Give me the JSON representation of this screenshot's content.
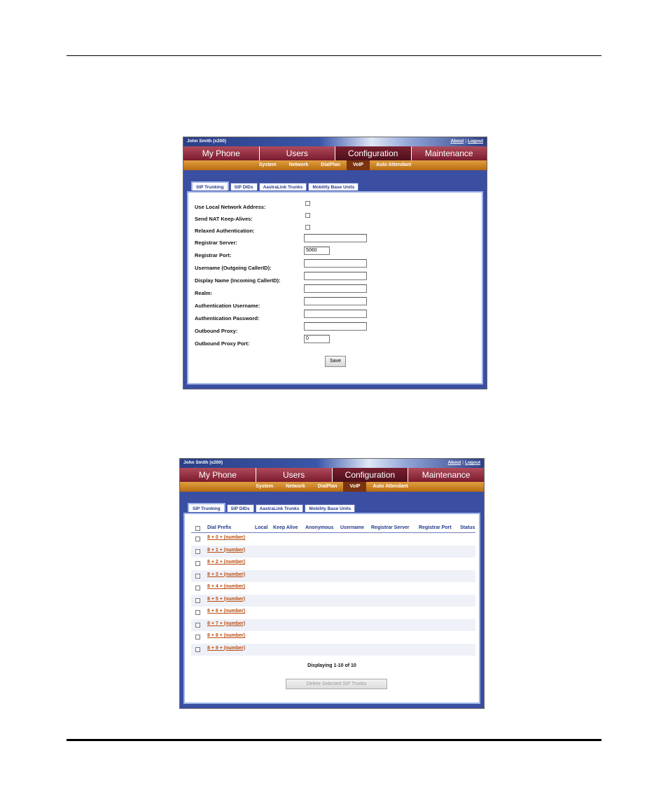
{
  "shot1": {
    "topbar": {
      "user": "John Smith (x200)",
      "about": "About",
      "separator": "|",
      "logout": "Logout"
    },
    "main_tabs": [
      "My Phone",
      "Users",
      "Configuration",
      "Maintenance"
    ],
    "sub_nav": [
      "System",
      "Network",
      "DialPlan",
      "VoIP",
      "Auto Attendant"
    ],
    "sub_tabs": [
      "SIP Trunking",
      "SIP DIDs",
      "AastraLink Trunks",
      "Mobility Base Units"
    ],
    "form": {
      "use_local_network_address": "Use Local Network Address:",
      "send_nat_keep_alives": "Send NAT Keep-Alives:",
      "relaxed_authentication": "Relaxed Authentication:",
      "registrar_server": "Registrar Server:",
      "registrar_port": "Registrar Port:",
      "registrar_port_value": "5060",
      "username": "Username (Outgoing CallerID):",
      "display_name": "Display Name (Incoming CallerID):",
      "realm": "Realm:",
      "auth_username": "Authentication Username:",
      "auth_password": "Authentication Password:",
      "outbound_proxy": "Outbound Proxy:",
      "outbound_proxy_port": "Outbound Proxy Port:",
      "outbound_proxy_port_value": "0",
      "save": "Save"
    }
  },
  "shot2": {
    "topbar": {
      "user": "John Smith (x200)",
      "about": "About",
      "separator": "|",
      "logout": "Logout"
    },
    "main_tabs": [
      "My Phone",
      "Users",
      "Configuration",
      "Maintenance"
    ],
    "sub_nav": [
      "System",
      "Network",
      "DialPlan",
      "VoIP",
      "Auto Attendant"
    ],
    "sub_tabs": [
      "SIP Trunking",
      "SIP DIDs",
      "AastraLink Trunks",
      "Mobility Base Units"
    ],
    "table": {
      "headers": [
        "Dial Prefix",
        "Local",
        "Keep Alive",
        "Anonymous",
        "Username",
        "Registrar Server",
        "Registrar Port",
        "Status"
      ],
      "rows": [
        "8 + 0 + (number)",
        "8 + 1 + (number)",
        "8 + 2 + (number)",
        "8 + 3 + (number)",
        "8 + 4 + (number)",
        "8 + 5 + (number)",
        "8 + 6 + (number)",
        "8 + 7 + (number)",
        "8 + 8 + (number)",
        "8 + 9 + (number)"
      ]
    },
    "displaying": "Displaying 1-10 of 10",
    "delete_button": "Delete Selected SIP Trunks"
  }
}
